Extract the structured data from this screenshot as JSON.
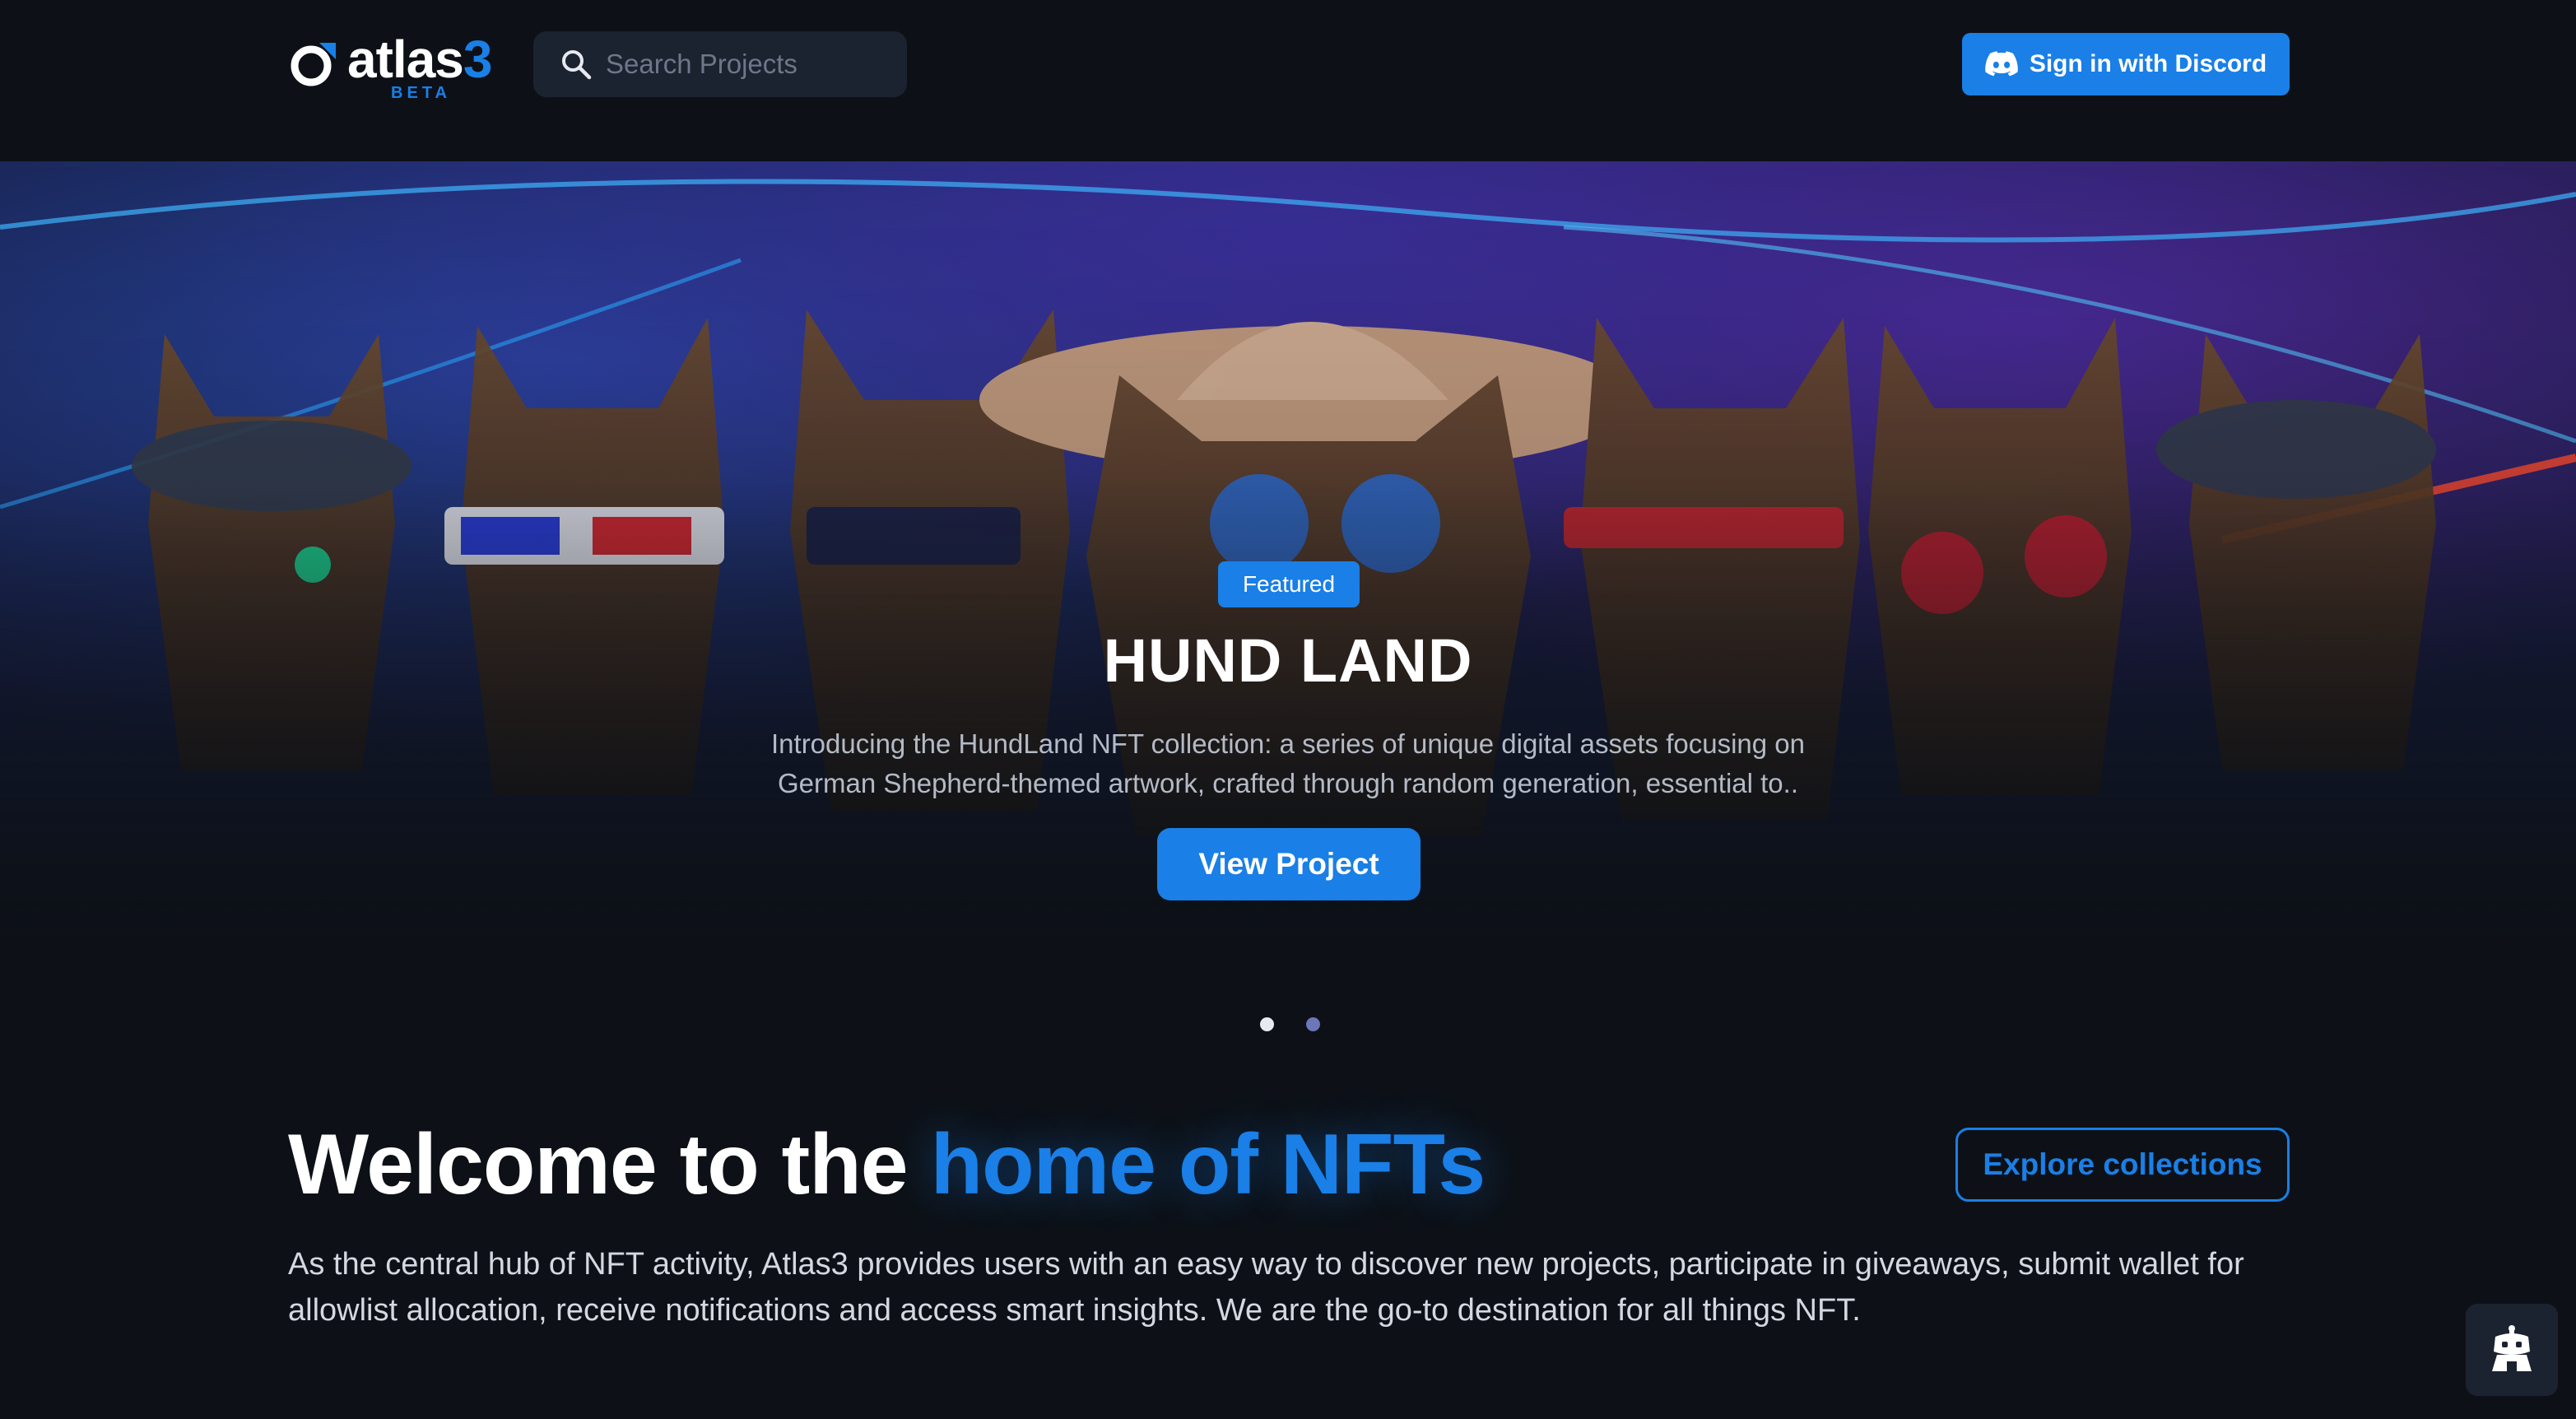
{
  "header": {
    "logo": {
      "name_main": "atlas",
      "name_accent": "3",
      "badge": "BETA"
    },
    "search": {
      "placeholder": "Search Projects",
      "value": ""
    },
    "sign_in_label": "Sign in with Discord"
  },
  "hero": {
    "badge": "Featured",
    "title": "HUND LAND",
    "description": "Introducing the HundLand NFT collection: a series of unique digital assets focusing on German Shepherd-themed artwork, crafted through random generation, essential to..",
    "cta_label": "View Project",
    "slides": 2,
    "active_slide": 1
  },
  "welcome": {
    "title_plain": "Welcome to the",
    "title_highlight": "home of NFTs",
    "explore_label": "Explore collections",
    "description": "As the central hub of NFT activity, Atlas3 provides users with an easy way to discover new projects, participate in giveaways, submit wallet for allowlist allocation, receive notifications and access smart insights. We are the go-to destination for all things NFT."
  },
  "chat_widget": {
    "icon": "robot-chat-icon"
  },
  "colors": {
    "background": "#0d1117",
    "accent": "#1a7fe6",
    "surface": "#1b2230",
    "muted_text": "#b4bac6"
  }
}
